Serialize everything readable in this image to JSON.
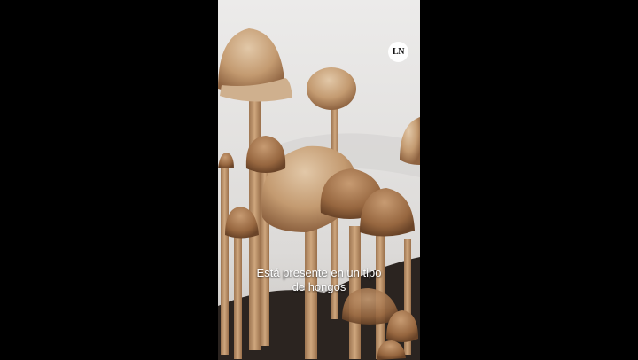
{
  "video": {
    "logo_text": "LN",
    "caption_line1": "Está presente en un tipo",
    "caption_line2": "de hongos"
  },
  "colors": {
    "letterbox": "#000000",
    "background": "#e8e6e4",
    "cap": "#c9a37a",
    "cap_dark": "#9c7048",
    "stem": "#b88f66",
    "soil": "#2b2420"
  }
}
